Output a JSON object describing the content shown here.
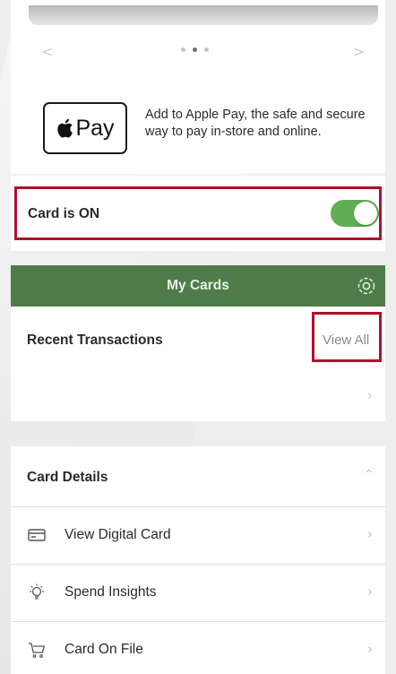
{
  "carousel": {
    "prev_glyph": "<",
    "next_glyph": ">",
    "page_count": 3,
    "active_page": 2
  },
  "apple_pay": {
    "badge_label": "Pay",
    "description": "Add to Apple Pay, the safe and secure way to pay in-store and online."
  },
  "card_status": {
    "label": "Card is ON",
    "toggle_on": true,
    "toggle_color": "#5fae54"
  },
  "my_cards": {
    "label": "My Cards",
    "bar_color": "#4e7d4a",
    "icon": "settings-icon"
  },
  "recent_transactions": {
    "label": "Recent Transactions",
    "view_all_label": "View All",
    "highlight_color": "#b0102a"
  },
  "card_details": {
    "title": "Card Details",
    "items": [
      {
        "label": "View Digital Card",
        "icon": "card-icon"
      },
      {
        "label": "Spend Insights",
        "icon": "lightbulb-icon"
      },
      {
        "label": "Card On File",
        "icon": "cart-icon"
      }
    ]
  }
}
